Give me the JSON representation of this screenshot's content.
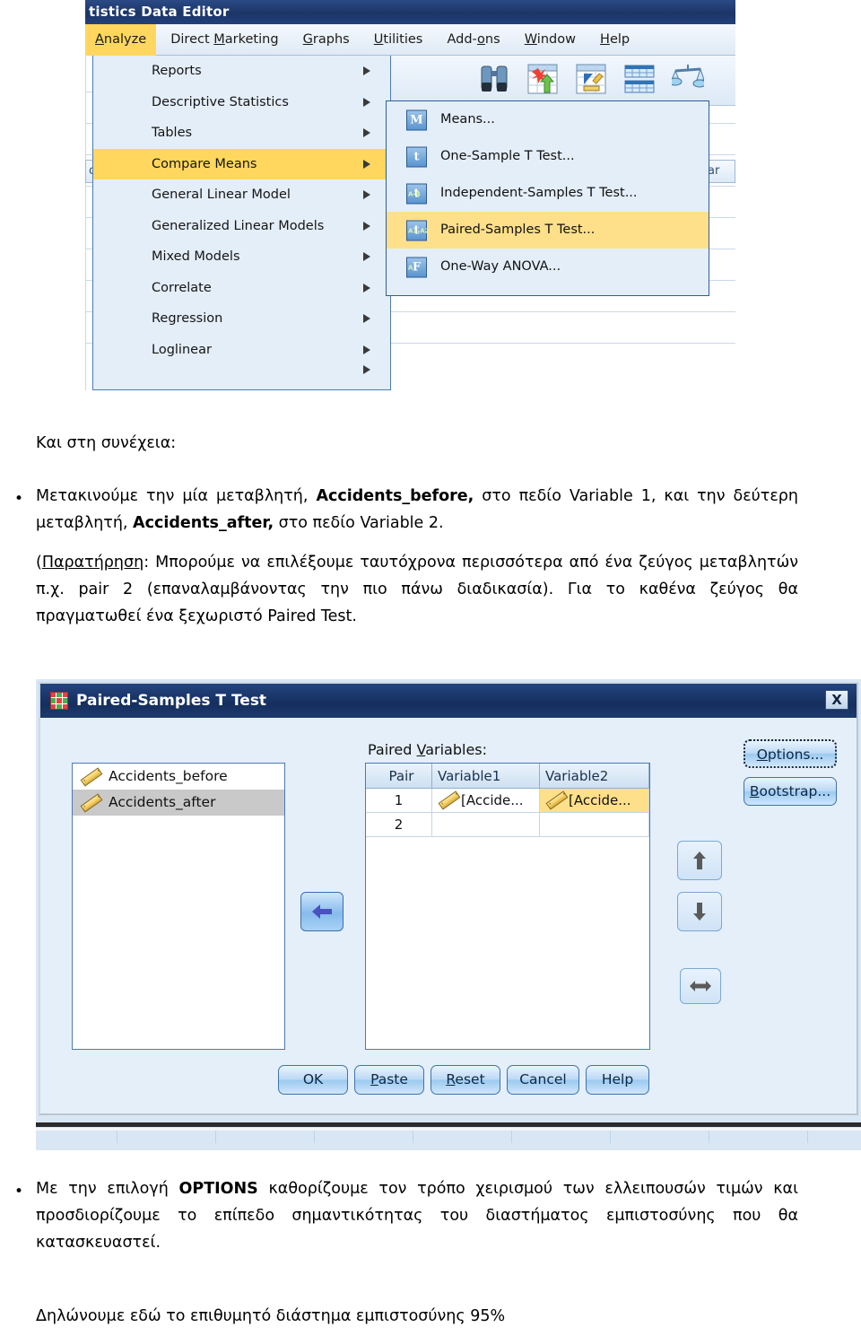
{
  "spss_window": {
    "title": "tistics Data Editor",
    "menubar": [
      {
        "label": "Analyze",
        "accel": "A",
        "active": true
      },
      {
        "label": "Direct Marketing",
        "accel": "M",
        "active": false
      },
      {
        "label": "Graphs",
        "accel": "G",
        "active": false
      },
      {
        "label": "Utilities",
        "accel": "U",
        "active": false
      },
      {
        "label": "Add-ons",
        "accel": "o",
        "active": false
      },
      {
        "label": "Window",
        "accel": "W",
        "active": false
      },
      {
        "label": "Help",
        "accel": "H",
        "active": false
      }
    ],
    "analyze_menu": [
      {
        "label": "Reports",
        "selected": false
      },
      {
        "label": "Descriptive Statistics",
        "selected": false
      },
      {
        "label": "Tables",
        "selected": false
      },
      {
        "label": "Compare Means",
        "selected": true
      },
      {
        "label": "General Linear Model",
        "selected": false
      },
      {
        "label": "Generalized Linear Models",
        "selected": false
      },
      {
        "label": "Mixed Models",
        "selected": false
      },
      {
        "label": "Correlate",
        "selected": false
      },
      {
        "label": "Regression",
        "selected": false
      },
      {
        "label": "Loglinear",
        "selected": false
      }
    ],
    "compare_means_submenu": [
      {
        "label": "Means...",
        "icon": "M",
        "sub": "",
        "selected": false
      },
      {
        "label": "One-Sample T Test...",
        "icon": "t",
        "sub": "",
        "selected": false
      },
      {
        "label": "Independent-Samples T Test...",
        "icon": "t",
        "sub": "A-B",
        "selected": false
      },
      {
        "label": "Paired-Samples T Test...",
        "icon": "t",
        "sub": "A1-A2",
        "selected": true
      },
      {
        "label": "One-Way ANOVA...",
        "icon": "F",
        "sub": "A",
        "selected": false
      }
    ],
    "toolbar_icons": [
      "binoculars-icon",
      "goto-case-icon",
      "variables-icon",
      "split-file-icon",
      "weight-cases-icon"
    ],
    "sheet_header_cell": "cc"
  },
  "body_text": {
    "lead": "Και στη συνέχεια:",
    "bullet_glyph": "•",
    "para1_a": "Μετακινούμε την μία μεταβλητή, ",
    "para1_b": "Accidents_before,",
    "para1_c": " στο πεδίο Variable 1, και την δεύτερη μεταβλητή, ",
    "para1_d": "Accidents_after,",
    "para1_e": " στο πεδίο Variable 2.",
    "para2_a": "(",
    "para2_u": "Παρατήρηση",
    "para2_b": ": Μπορούμε να επιλέξουμε ταυτόχρονα περισσότερα από ένα ζεύγος μεταβλητών π.χ. pair 2 (επαναλαμβάνοντας την πιο πάνω διαδικασία). Για το καθένα ζεύγος θα πραγματωθεί ένα ξεχωριστό Paired Test.",
    "para3_a": "Με την επιλογή ",
    "para3_b": "OPTIONS",
    "para3_c": " καθορίζουμε τον τρόπο χειρισμού των ελλειπουσών τιμών και προσδιορίζουμε το επίπεδο σημαντικότητας του διαστήματος εμπιστοσύνης που θα κατασκευαστεί.",
    "para4": "Δηλώνουμε εδώ το επιθυμητό διάστημα εμπιστοσύνης 95%"
  },
  "dialog": {
    "title": "Paired-Samples T Test",
    "close_label": "X",
    "source_variables": [
      {
        "name": "Accidents_before",
        "selected": false
      },
      {
        "name": "Accidents_after",
        "selected": true
      }
    ],
    "paired_variables_label_a": "Paired ",
    "paired_variables_label_u": "V",
    "paired_variables_label_b": "ariables:",
    "table_headers": [
      "Pair",
      "Variable1",
      "Variable2"
    ],
    "table_rows": [
      {
        "pair": "1",
        "variable1": "[Accide...",
        "variable2": "[Accide...",
        "v2_highlight": true
      },
      {
        "pair": "2",
        "variable1": "",
        "variable2": "",
        "v2_highlight": false
      }
    ],
    "side_buttons": [
      {
        "label": "Options...",
        "accel": "O",
        "name": "options-button",
        "focused": true
      },
      {
        "label": "Bootstrap...",
        "accel": "B",
        "name": "bootstrap-button",
        "focused": false
      }
    ],
    "arrow_buttons": [
      {
        "name": "move-to-pairs-button",
        "glyph": "left-arrow-icon"
      },
      {
        "name": "move-pair-up-button",
        "glyph": "up-arrow-icon"
      },
      {
        "name": "move-pair-down-button",
        "glyph": "down-arrow-icon"
      },
      {
        "name": "swap-pair-button",
        "glyph": "left-right-arrow-icon"
      }
    ],
    "footer_buttons": [
      {
        "label": "OK",
        "accel": ""
      },
      {
        "label": "Paste",
        "accel": "P"
      },
      {
        "label": "Reset",
        "accel": "R"
      },
      {
        "label": "Cancel",
        "accel": "C"
      },
      {
        "label": "Help",
        "accel": "H"
      }
    ]
  },
  "colors": {
    "menu_highlight": "#ffd75e",
    "submenu_highlight": "#ffe08a",
    "dialog_bg": "#e4effa",
    "titlebar": "#1b3566",
    "selected_row": "#c9c9c9"
  }
}
